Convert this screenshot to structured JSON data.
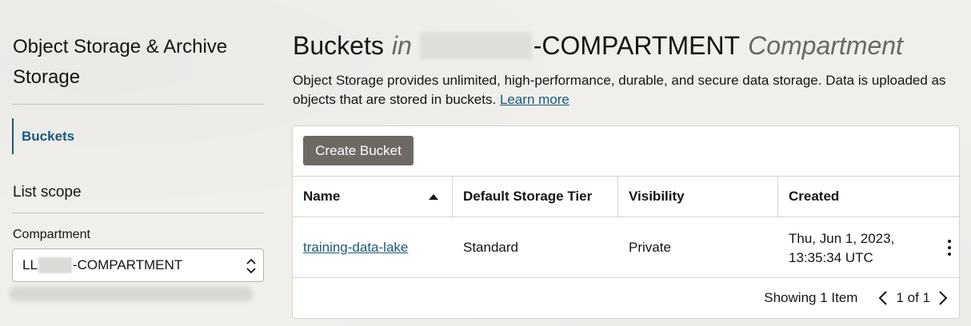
{
  "sidebar": {
    "title": "Object Storage & Archive Storage",
    "nav_items": [
      {
        "label": "Buckets",
        "active": true
      }
    ],
    "list_scope_title": "List scope",
    "compartment": {
      "label": "Compartment",
      "prefix": "LL",
      "suffix": "-COMPARTMENT"
    }
  },
  "main": {
    "title": {
      "prefix": "Buckets",
      "in": "in",
      "compartment_name": "-COMPARTMENT",
      "suffix": "Compartment"
    },
    "description": "Object Storage provides unlimited, high-performance, durable, and secure data storage. Data is uploaded as objects that are stored in buckets.",
    "learn_more": "Learn more",
    "create_button": "Create Bucket",
    "table": {
      "columns": [
        "Name",
        "Default Storage Tier",
        "Visibility",
        "Created"
      ],
      "rows": [
        {
          "name": "training-data-lake",
          "tier": "Standard",
          "visibility": "Private",
          "created_line1": "Thu, Jun 1, 2023,",
          "created_line2": "13:35:34 UTC"
        }
      ]
    },
    "footer": {
      "showing": "Showing 1 Item",
      "page": "1 of 1"
    }
  },
  "colors": {
    "accent": "#1a5a7a",
    "button": "#6f6964",
    "background": "#f1efec"
  }
}
